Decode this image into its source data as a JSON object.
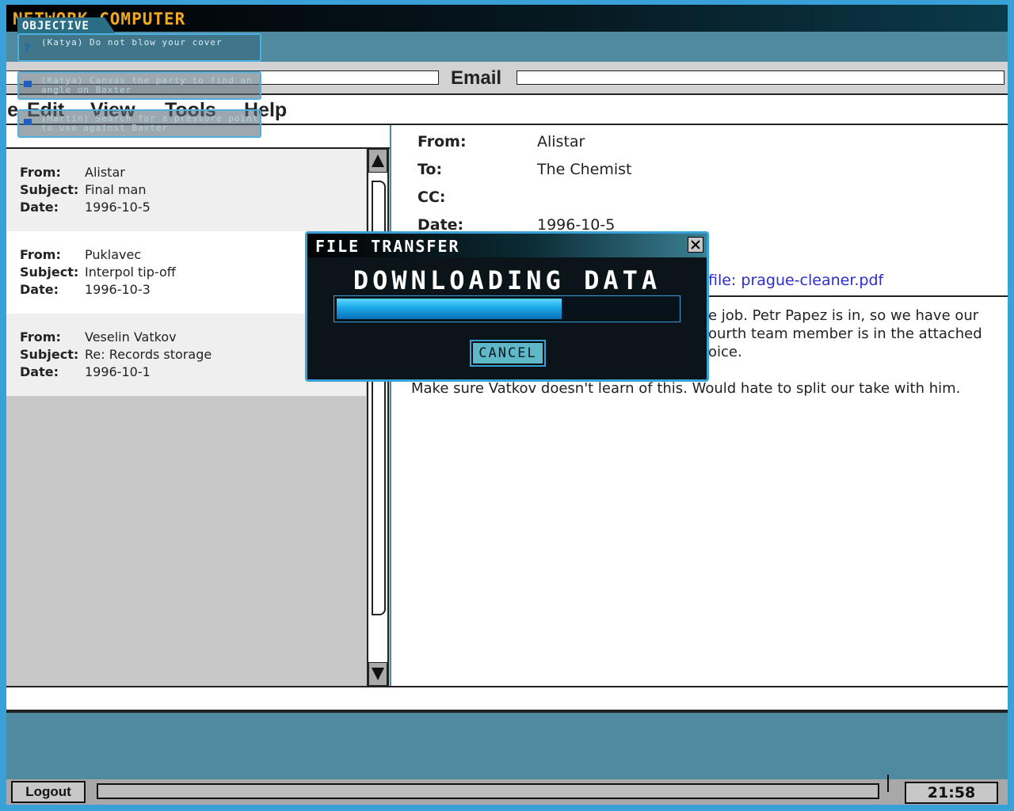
{
  "window": {
    "title": "NETWORK COMPUTER"
  },
  "address_bar": {
    "label": "Email"
  },
  "menu": [
    "File",
    "Edit",
    "View",
    "Tools",
    "Help"
  ],
  "objectives": {
    "header": "OBJECTIVE",
    "items": [
      {
        "text": "(Katya) Do not blow your cover",
        "icon": "question-icon"
      },
      {
        "text": "(Katya) Canvas the party to find an angle on Baxter",
        "icon": "flag-icon"
      },
      {
        "text": "(Martin) Search for a pressure point to use against Baxter",
        "icon": "flag-icon"
      }
    ]
  },
  "field_labels": {
    "from": "From:",
    "subject": "Subject:",
    "date": "Date:",
    "to": "To:",
    "cc": "CC:"
  },
  "messages": [
    {
      "from": "Alistar",
      "subject": "Final man",
      "date": "1996-10-5"
    },
    {
      "from": "Puklavec",
      "subject": "Interpol tip-off",
      "date": "1996-10-3"
    },
    {
      "from": "Veselin Vatkov",
      "subject": "Re: Records storage",
      "date": "1996-10-1"
    }
  ],
  "email": {
    "from": "Alistar",
    "to": "The Chemist",
    "cc": "",
    "date": "1996-10-5",
    "attachment": "file: prague-cleaner.pdf",
    "body_lines": [
      "e job. Petr Papez is in, so we have our",
      "ourth team member is in the attached",
      "oice.",
      "Make sure Vatkov doesn't learn of this. Would hate to split our take with him."
    ]
  },
  "dialog": {
    "title": "FILE TRANSFER",
    "message": "DOWNLOADING DATA",
    "progress": 0.66,
    "cancel_label": "CANCEL"
  },
  "taskbar": {
    "logout_label": "Logout",
    "clock": "21:58"
  },
  "colors": {
    "accent": "#3aa0d8",
    "title_text": "#f0a820",
    "background": "#4f8aa0",
    "link": "#2c2cd0"
  }
}
